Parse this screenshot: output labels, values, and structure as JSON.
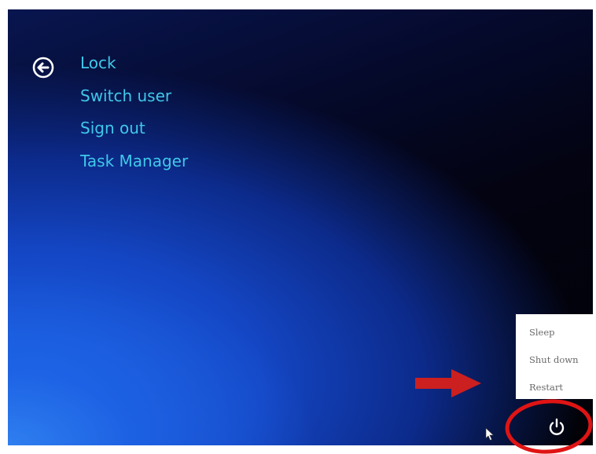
{
  "menu": {
    "items": [
      "Lock",
      "Switch user",
      "Sign out",
      "Task Manager"
    ]
  },
  "power_menu": {
    "sleep": "Sleep",
    "shut_down": "Shut down",
    "restart": "Restart"
  },
  "icons": {
    "back": "back-arrow-circle-icon",
    "power": "power-icon",
    "pointer": "mouse-pointer-icon"
  },
  "annotations": {
    "arrow_color": "#cc1f1f",
    "circle_color": "#e01414"
  },
  "colors": {
    "menu_text": "#3fc8ea",
    "power_menu_bg": "#ffffff"
  }
}
